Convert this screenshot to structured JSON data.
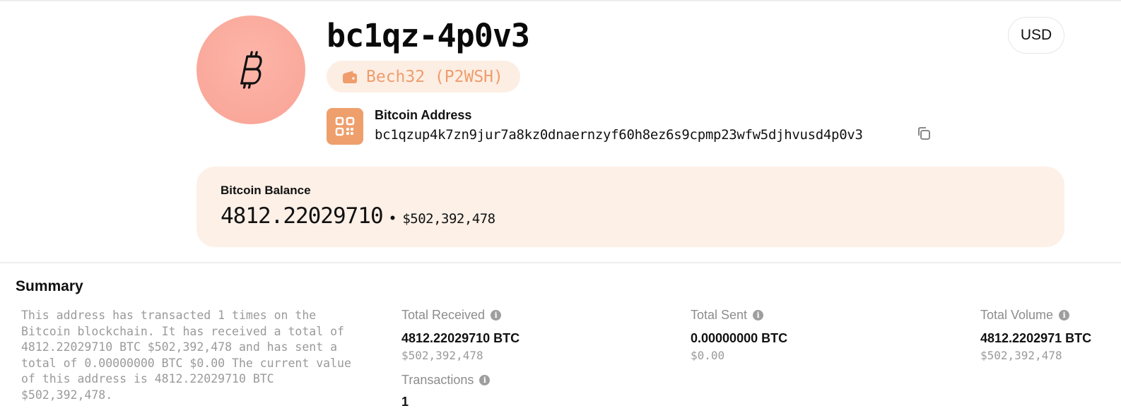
{
  "header": {
    "short_address": "bc1qz-4p0v3",
    "address_type": "Bech32 (P2WSH)",
    "address_label": "Bitcoin Address",
    "full_address": "bc1qzup4k7zn9jur7a8kz0dnaernzyf60h8ez6s9cpmp23wfw5djhvusd4p0v3",
    "currency": "USD",
    "avatar_icon": "bitcoin-icon",
    "type_icon": "wallet-icon",
    "qr_icon": "qr-code-icon",
    "copy_icon": "copy-icon",
    "colors": {
      "avatar": "#f9a395",
      "accent": "#ee9f6c",
      "pill_bg": "#fdeee4",
      "card_bg": "#fdf0e7"
    }
  },
  "balance": {
    "label": "Bitcoin Balance",
    "btc": "4812.22029710",
    "separator": "•",
    "usd": "$502,392,478"
  },
  "summary": {
    "title": "Summary",
    "text": "This address has transacted 1 times on the Bitcoin blockchain. It has received a total of 4812.22029710 BTC $502,392,478 and has sent a total of 0.00000000 BTC $0.00 The current value of this address is 4812.22029710 BTC $502,392,478.",
    "stats": {
      "total_received": {
        "label": "Total Received",
        "value": "4812.22029710 BTC",
        "sub": "$502,392,478"
      },
      "total_sent": {
        "label": "Total Sent",
        "value": "0.00000000 BTC",
        "sub": "$0.00"
      },
      "total_volume": {
        "label": "Total Volume",
        "value": "4812.2202971 BTC",
        "sub": "$502,392,478"
      },
      "transactions": {
        "label": "Transactions",
        "value": "1"
      }
    },
    "info_glyph": "i"
  }
}
